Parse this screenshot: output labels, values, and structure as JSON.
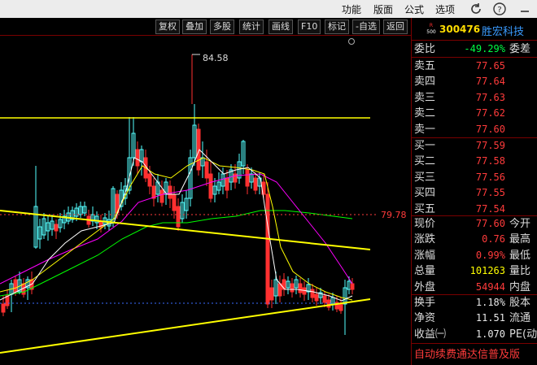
{
  "menu": {
    "items": [
      "功能",
      "版面",
      "公式",
      "选项"
    ],
    "icons": [
      "refresh-icon",
      "help-icon",
      "minimize-icon"
    ]
  },
  "toolbar": {
    "buttons": [
      "复权",
      "叠加",
      "多股",
      "统计",
      "画线",
      "F10",
      "标记",
      "-自选",
      "返回"
    ]
  },
  "stock": {
    "market_badge_top": "R",
    "market_badge_bottom": "500",
    "code": "300476",
    "name": "胜宏科技"
  },
  "weibi": {
    "label": "委比",
    "value": "-49.29%",
    "label2": "委差"
  },
  "asks": [
    {
      "label": "卖五",
      "price": "77.65"
    },
    {
      "label": "卖四",
      "price": "77.64"
    },
    {
      "label": "卖三",
      "price": "77.63"
    },
    {
      "label": "卖二",
      "price": "77.62"
    },
    {
      "label": "卖一",
      "price": "77.60"
    }
  ],
  "bids": [
    {
      "label": "买一",
      "price": "77.59"
    },
    {
      "label": "买二",
      "price": "77.58"
    },
    {
      "label": "买三",
      "price": "77.56"
    },
    {
      "label": "买四",
      "price": "77.55"
    },
    {
      "label": "买五",
      "price": "77.54"
    }
  ],
  "quote": [
    {
      "label": "现价",
      "value": "77.60",
      "label2": "今开",
      "color": "#ff3b3b"
    },
    {
      "label": "涨跌",
      "value": "0.76",
      "label2": "最高",
      "color": "#ff3b3b"
    },
    {
      "label": "涨幅",
      "value": "0.99%",
      "label2": "最低",
      "color": "#ff3b3b"
    },
    {
      "label": "总量",
      "value": "101263",
      "label2": "量比",
      "color": "#ffff00"
    },
    {
      "label": "外盘",
      "value": "54944",
      "label2": "内盘",
      "color": "#ff3b3b"
    }
  ],
  "fundamentals": [
    {
      "label": "换手",
      "value": "1.18%",
      "label2": "股本"
    },
    {
      "label": "净资",
      "value": "11.51",
      "label2": "流通"
    },
    {
      "label": "收益㈠",
      "value": "1.070",
      "label2": "PE(动"
    }
  ],
  "ad_text": "自动续费通达信普及版",
  "chart": {
    "high_label": "84.58",
    "price_level_label": "79.78",
    "colors": {
      "up": "#54ffff",
      "down": "#ff3030",
      "ma5": "#ffffff",
      "ma10": "#ffff00",
      "ma20": "#ff00ff",
      "ma60": "#00ff00",
      "trend": "#ffff00"
    }
  }
}
